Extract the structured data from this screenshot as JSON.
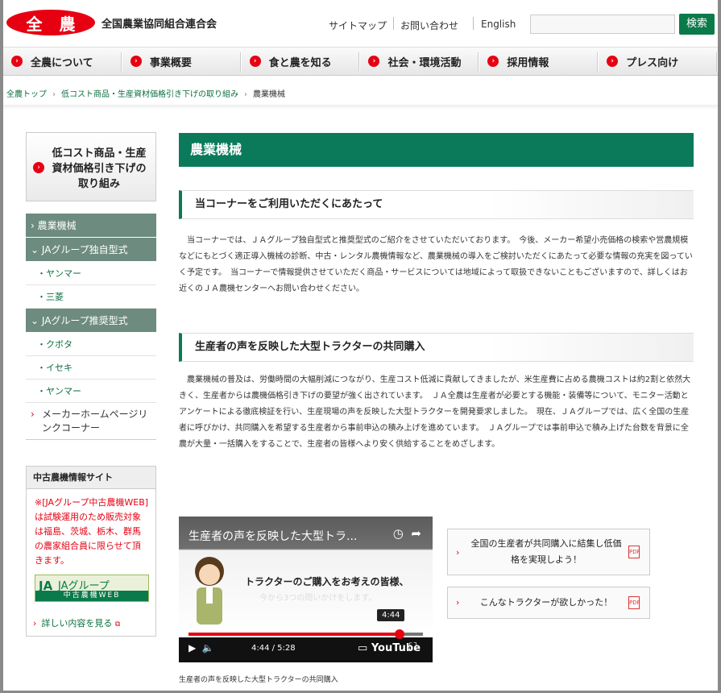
{
  "header": {
    "logo_char1": "全",
    "logo_char2": "農",
    "org_name": "全国農業協同組合連合会",
    "sitemap": "サイトマップ",
    "contact": "お問い合わせ",
    "english": "English",
    "search_placeholder": "",
    "search_button": "検索"
  },
  "nav": {
    "items": [
      {
        "label": "全農について"
      },
      {
        "label": "事業概要"
      },
      {
        "label": "食と農を知る"
      },
      {
        "label": "社会・環境活動"
      },
      {
        "label": "採用情報"
      },
      {
        "label": "プレス向け"
      }
    ]
  },
  "breadcrumb": {
    "home": "全農トップ",
    "parent": "低コスト商品・生産資材価格引き下げの取り組み",
    "current": "農業機械"
  },
  "sidebar": {
    "top_link": "低コスト商品・生産資材価格引き下げの取り組み",
    "menu": {
      "agri_machinery": "› 農業機械",
      "ja_original": "⌄ JAグループ独自型式",
      "ja_original_items": [
        "・ヤンマー",
        "・三菱"
      ],
      "ja_recommended": "⌄ JAグループ推奨型式",
      "ja_recommended_items": [
        "・クボタ",
        "・イセキ",
        "・ヤンマー"
      ],
      "maker_link": "メーカーホームページリンクコーナー"
    },
    "used_box": {
      "heading": "中古農機情報サイト",
      "note": "※[JAグループ中古農機WEB]は試験運用のため販売対象は福島、茨城、栃木、群馬の農家組合員に限らせて頂きます。",
      "banner_t1": "JAグループ",
      "banner_t2": "中古農機WEB",
      "more": "詳しい内容を見る"
    }
  },
  "main": {
    "title": "農業機械",
    "section1": {
      "heading": "当コーナーをご利用いただくにあたって",
      "body": "　当コーナーでは、ＪＡグループ独自型式と推奨型式のご紹介をさせていただいております。　今後、メーカー希望小売価格の検索や営農規模などにもとづく適正導入機械の診断、中古・レンタル農機情報など、農業機械の導入をご検討いただくにあたって必要な情報の充実を図っていく予定です。　当コーナーで情報提供させていただく商品・サービスについては地域によって取扱できないこともございますので、詳しくはお近くのＪＡ農機センターへお問い合わせください。"
    },
    "section2": {
      "heading": "生産者の声を反映した大型トラクターの共同購入",
      "body": "　農業機械の普及は、労働時間の大幅削減につながり、生産コスト低減に貢献してきましたが、米生産費に占める農機コストは約2割と依然大きく、生産者からは農機価格引き下げの要望が強く出されています。　ＪＡ全農は生産者が必要とする機能・装備等について、モニター活動とアンケートによる徹底検証を行い、生産現場の声を反映した大型トラクターを開発要求しました。　現在、ＪＡグループでは、広く全国の生産者に呼びかけ、共同購入を希望する生産者から事前申込の積み上げを進めています。　ＪＡグループでは事前申込で積み上げた台数を背景に全農が大量・一括購入をすることで、生産者の皆様へより安く供給することをめざします。"
    },
    "video": {
      "title": "生産者の声を反映した大型トラ...",
      "slogan": "トラクターのご購入をお考えの皆様、",
      "sub": "今から3つの問いかけをします。",
      "tooltip": "4:44",
      "time": "4:44 / 5:28",
      "progress": 0.9,
      "brand": "YouTube",
      "caption": "生産者の声を反映した大型トラクターの共同購入"
    },
    "pdf_buttons": [
      {
        "label": "全国の生産者が共同購入に結集し低価格を実現しよう！"
      },
      {
        "label": "こんなトラクターが欲しかった！"
      }
    ]
  }
}
